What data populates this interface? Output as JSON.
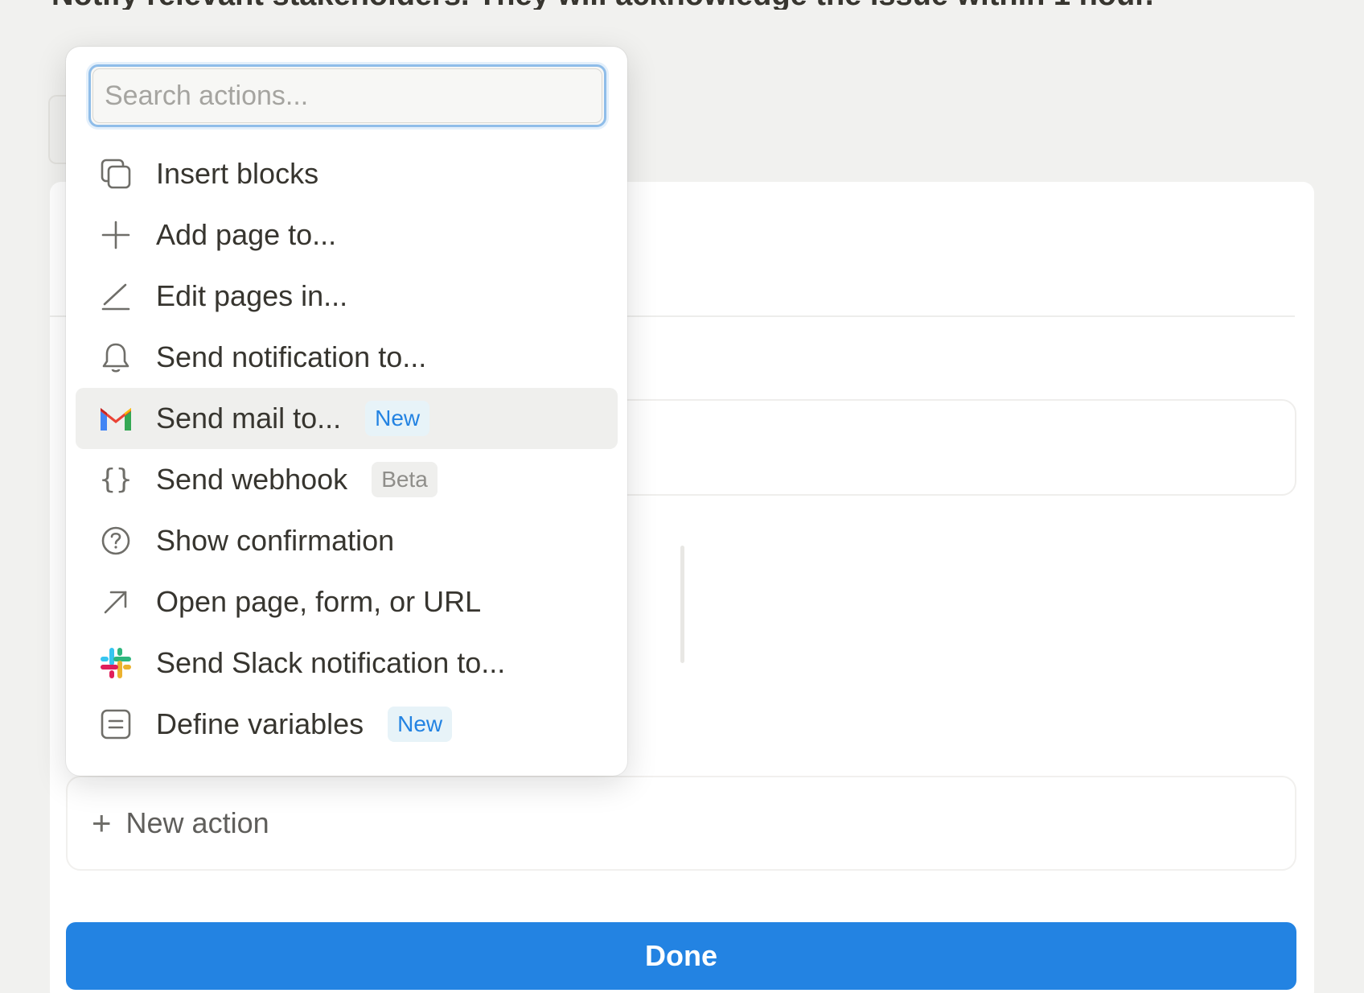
{
  "page": {
    "top_text": "Notify relevant stakeholders. They will acknowledge the issue within 1 hour."
  },
  "search": {
    "placeholder": "Search actions..."
  },
  "menu": {
    "items": [
      {
        "label": "Insert blocks",
        "icon": "copy-blocks-icon"
      },
      {
        "label": "Add page to...",
        "icon": "plus-icon"
      },
      {
        "label": "Edit pages in...",
        "icon": "pencil-icon"
      },
      {
        "label": "Send notification to...",
        "icon": "bell-icon"
      },
      {
        "label": "Send mail to...",
        "icon": "gmail-icon",
        "badge": "New",
        "hovered": true
      },
      {
        "label": "Send webhook",
        "icon": "braces-icon",
        "badge": "Beta"
      },
      {
        "label": "Show confirmation",
        "icon": "question-circle-icon"
      },
      {
        "label": "Open page, form, or URL",
        "icon": "arrow-up-right-icon"
      },
      {
        "label": "Send Slack notification to...",
        "icon": "slack-icon"
      },
      {
        "label": "Define variables",
        "icon": "variables-icon",
        "badge": "New"
      }
    ]
  },
  "panel": {
    "new_action_label": "New action",
    "done_label": "Done"
  },
  "colors": {
    "accent": "#2383e2",
    "background": "#f1f1ef",
    "badge_new_bg": "#e7f3f8",
    "badge_beta_bg": "#efefed"
  }
}
